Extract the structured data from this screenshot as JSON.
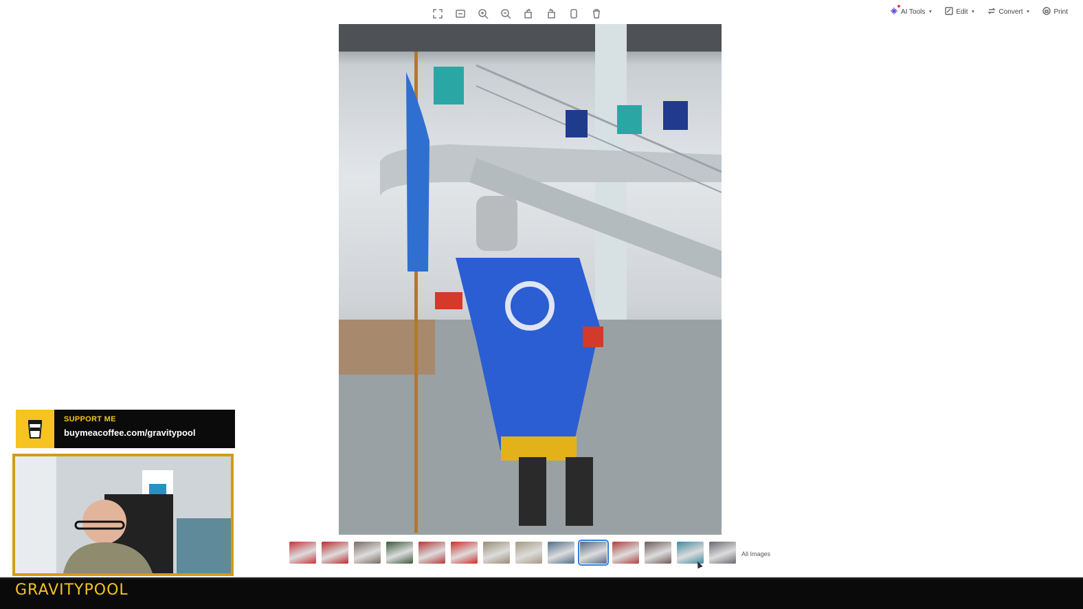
{
  "toolbar": {
    "icons": [
      "fullscreen-icon",
      "fit-icon",
      "zoom-in-icon",
      "zoom-out-icon",
      "rotate-left-icon",
      "rotate-right-icon",
      "mark-icon",
      "delete-icon"
    ],
    "ai_tools_label": "AI Tools",
    "edit_label": "Edit",
    "convert_label": "Convert",
    "print_label": "Print"
  },
  "gallery": {
    "all_images_label": "All Images",
    "thumbnail_colors": [
      "#c7333a",
      "#b92c2f",
      "#7b6a62",
      "#3b5a3a",
      "#b6383a",
      "#d32b28",
      "#9a8c74",
      "#a79a82",
      "#4f6f8a",
      "#5a6a82",
      "#b0403e",
      "#6e5b59",
      "#3f8ba0",
      "#6b6870"
    ],
    "active_index": 9
  },
  "overlay": {
    "support_title": "SUPPORT ME",
    "support_url_prefix": "buymeacoffee.com/",
    "support_url_name": "gravitypool",
    "streamer_name": "GRAVITYPOOL"
  },
  "colors": {
    "accent": "#f6c320",
    "thumb_active": "#2f7de1"
  }
}
